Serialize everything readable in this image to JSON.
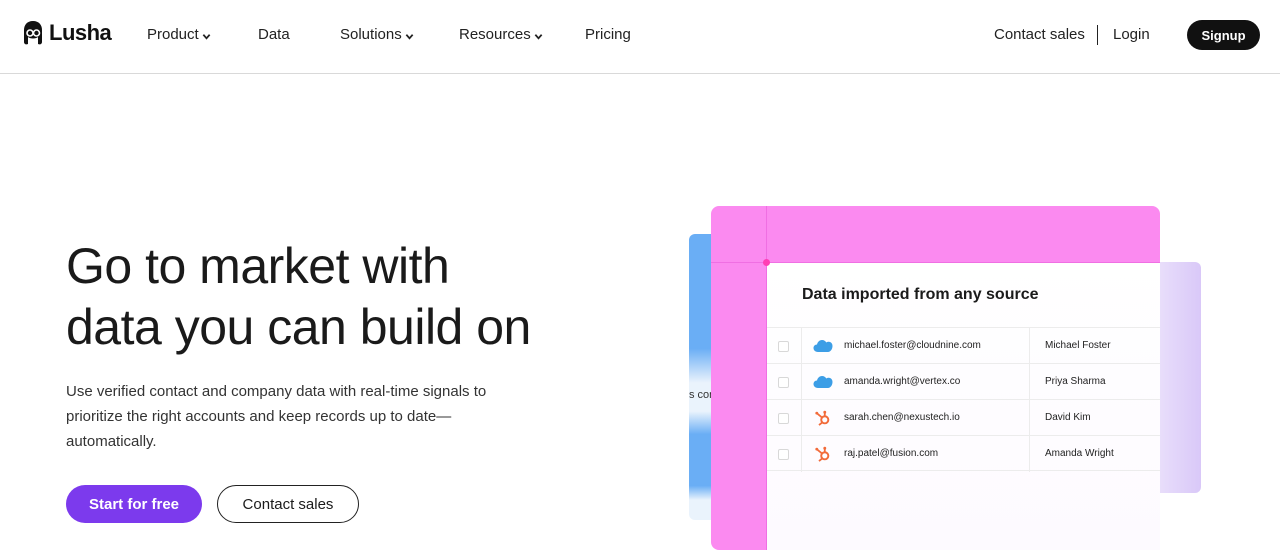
{
  "nav": {
    "brand": "Lusha",
    "items": [
      {
        "label": "Product",
        "has_dropdown": true
      },
      {
        "label": "Data",
        "has_dropdown": false
      },
      {
        "label": "Solutions",
        "has_dropdown": true
      },
      {
        "label": "Resources",
        "has_dropdown": true
      },
      {
        "label": "Pricing",
        "has_dropdown": false
      }
    ],
    "contact_sales": "Contact sales",
    "login": "Login",
    "signup": "Signup"
  },
  "hero": {
    "headline_line1": "Go to market with",
    "headline_line2": "data you can build on",
    "subtext": "Use verified contact and company data with real-time signals to prioritize the right accounts and keep records up to date—automatically.",
    "primary_cta": "Start for free",
    "secondary_cta": "Contact sales"
  },
  "illustration": {
    "side_panel_text": "s cor",
    "card_title": "Data imported from any source",
    "rows": [
      {
        "source_icon": "salesforce-cloud-icon",
        "email": "michael.foster@cloudnine.com",
        "name": "Michael Foster"
      },
      {
        "source_icon": "salesforce-cloud-icon",
        "email": "amanda.wright@vertex.co",
        "name": "Priya Sharma"
      },
      {
        "source_icon": "hubspot-sprocket-icon",
        "email": "sarah.chen@nexustech.io",
        "name": "David Kim"
      },
      {
        "source_icon": "hubspot-sprocket-icon",
        "email": "raj.patel@fusion.com",
        "name": "Amanda Wright"
      }
    ]
  },
  "colors": {
    "primary_purple": "#7c3aed",
    "pink_panel": "#fb8af0",
    "blue_panel": "#6aaef5",
    "salesforce_blue": "#3c9ee6",
    "hubspot_orange": "#f26b3a"
  }
}
